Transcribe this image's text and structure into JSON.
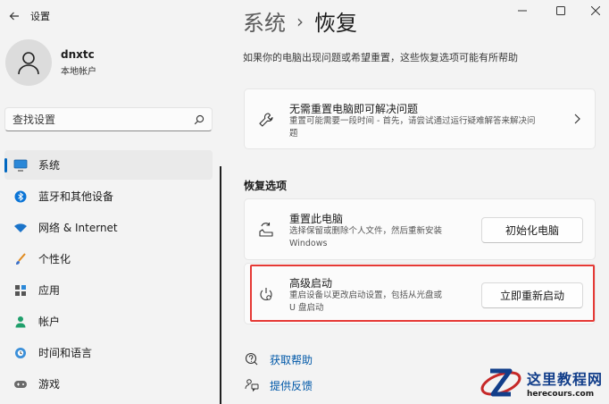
{
  "app": {
    "title": "设置"
  },
  "user": {
    "name": "dnxtc",
    "account_type": "本地帐户"
  },
  "search": {
    "placeholder": "查找设置"
  },
  "nav": {
    "items": [
      {
        "label": "系统",
        "icon": "monitor-icon",
        "active": true
      },
      {
        "label": "蓝牙和其他设备",
        "icon": "bluetooth-icon"
      },
      {
        "label": "网络 & Internet",
        "icon": "wifi-icon"
      },
      {
        "label": "个性化",
        "icon": "brush-icon"
      },
      {
        "label": "应用",
        "icon": "apps-icon"
      },
      {
        "label": "帐户",
        "icon": "person-icon"
      },
      {
        "label": "时间和语言",
        "icon": "globe-clock-icon"
      },
      {
        "label": "游戏",
        "icon": "gamepad-icon"
      }
    ]
  },
  "breadcrumb": {
    "parent": "系统",
    "separator": "›",
    "current": "恢复"
  },
  "page": {
    "description": "如果你的电脑出现问题或希望重置，这些恢复选项可能有所帮助"
  },
  "fix_card": {
    "title": "无需重置电脑即可解决问题",
    "subtitle_line1": "重置可能需要一段时间 - 首先，请尝试通过运行疑难解答来解决问",
    "subtitle_line2": "题"
  },
  "recovery": {
    "section_title": "恢复选项",
    "reset": {
      "title": "重置此电脑",
      "subtitle_line1": "选择保留或删除个人文件，然后重新安装",
      "subtitle_line2": "Windows",
      "button": "初始化电脑"
    },
    "advanced": {
      "title": "高级启动",
      "subtitle_line1": "重启设备以更改启动设置，包括从光盘或",
      "subtitle_line2": "U 盘启动",
      "button": "立即重新启动"
    }
  },
  "links": {
    "help": "获取帮助",
    "feedback": "提供反馈"
  },
  "watermark": {
    "title": "这里教程网",
    "url": "herecours.com"
  },
  "colors": {
    "accent": "#0067c0",
    "link": "#0058a8",
    "highlight": "#e53935",
    "background": "#f3f3f3",
    "card": "#fbfbfb"
  }
}
